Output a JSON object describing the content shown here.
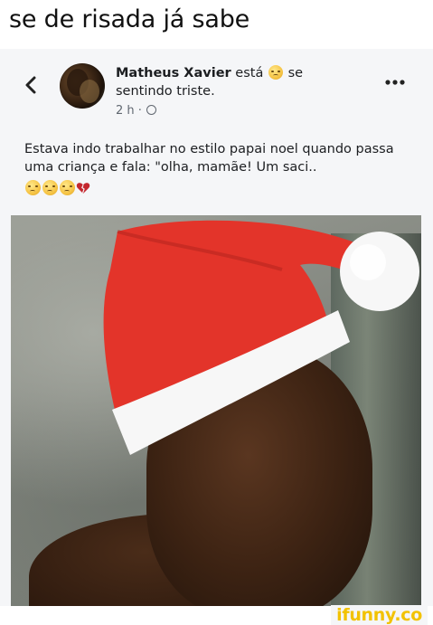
{
  "caption": "se de risada já sabe",
  "post": {
    "author": "Matheus Xavier",
    "feeling_prefix": "está",
    "feeling_suffix": "se sentindo triste.",
    "timestamp": "2 h ·",
    "text": "Estava indo trabalhar no estilo papai noel quando passa uma criança e fala: \"olha, mamãe! Um saci..",
    "emoji_row": [
      "sad-emoji",
      "sad-emoji",
      "sad-emoji",
      "broken-heart-emoji"
    ]
  },
  "icons": {
    "back": "chevron-left-icon",
    "more": "more-horizontal-icon",
    "privacy": "globe-icon"
  },
  "colors": {
    "hat_red": "#e3342a",
    "hat_white": "#f7f7f7",
    "watermark": "#f2c200"
  },
  "watermark": "ifunny.co"
}
